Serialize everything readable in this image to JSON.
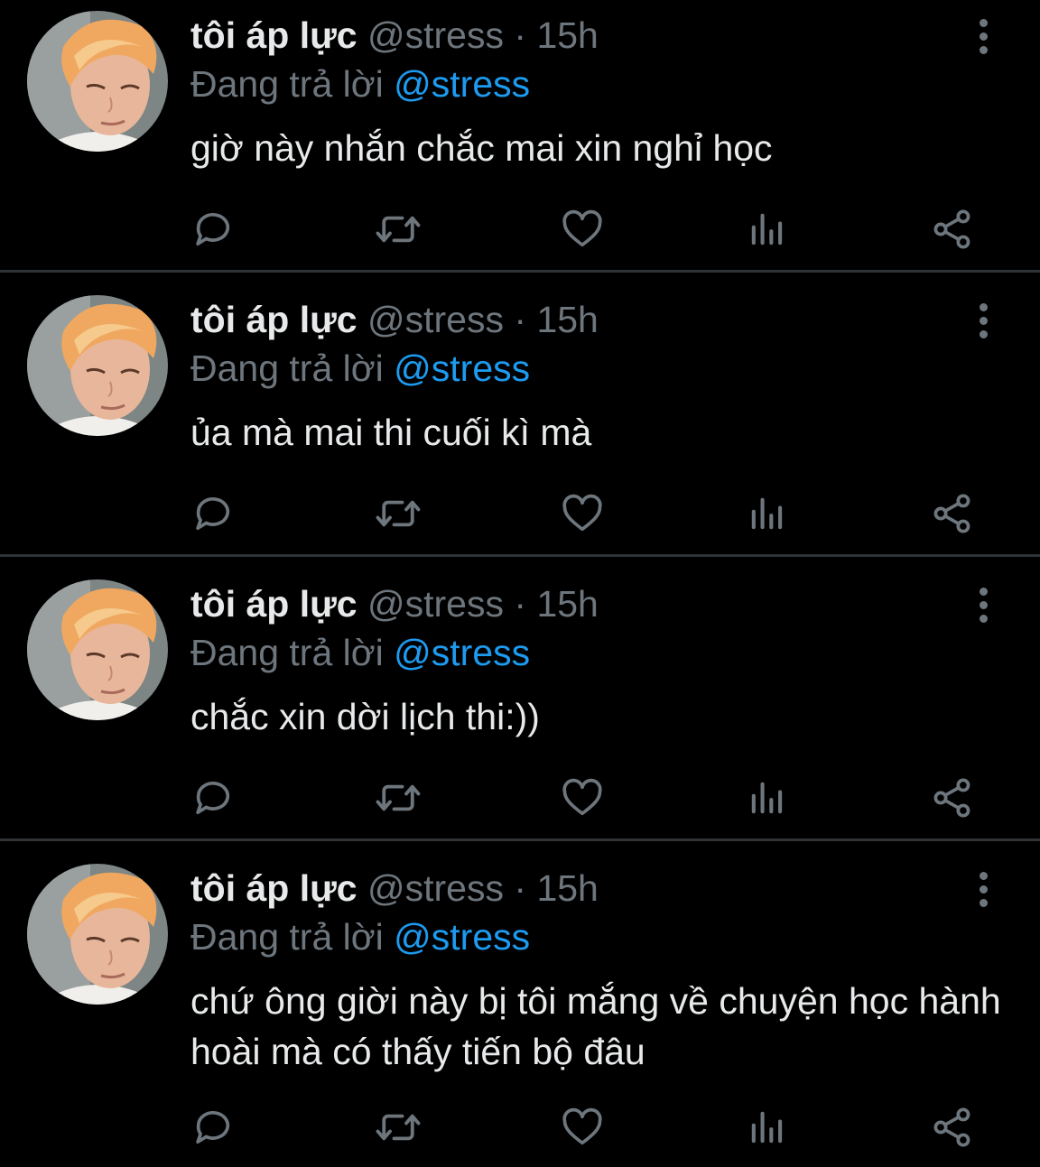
{
  "colors": {
    "background": "#000000",
    "text_primary": "#e7e9ea",
    "text_secondary": "#6e767d",
    "mention": "#1d9bf0",
    "divider": "#2f3336"
  },
  "icons": {
    "reply": "comment-bubble-icon",
    "retweet": "retweet-icon",
    "like": "heart-icon",
    "analytics": "analytics-bars-icon",
    "share": "share-icon",
    "more": "more-vertical-icon"
  },
  "tweets": [
    {
      "author_name": "tôi áp lực",
      "author_handle": "@stress",
      "separator": "·",
      "timestamp": "15h",
      "replying_prefix": "Đang trả lời",
      "replying_to": "@stress",
      "text": "giờ này nhắn chắc mai xin nghỉ học"
    },
    {
      "author_name": "tôi áp lực",
      "author_handle": "@stress",
      "separator": "·",
      "timestamp": "15h",
      "replying_prefix": "Đang trả lời",
      "replying_to": "@stress",
      "text": "ủa mà mai thi cuối kì mà"
    },
    {
      "author_name": "tôi áp lực",
      "author_handle": "@stress",
      "separator": "·",
      "timestamp": "15h",
      "replying_prefix": "Đang trả lời",
      "replying_to": "@stress",
      "text": "chắc xin dời lịch thi:))"
    },
    {
      "author_name": "tôi áp lực",
      "author_handle": "@stress",
      "separator": "·",
      "timestamp": "15h",
      "replying_prefix": "Đang trả lời",
      "replying_to": "@stress",
      "text": "chứ ông giời này bị tôi mắng về chuyện học hành hoài mà có thấy tiến bộ đâu"
    }
  ]
}
